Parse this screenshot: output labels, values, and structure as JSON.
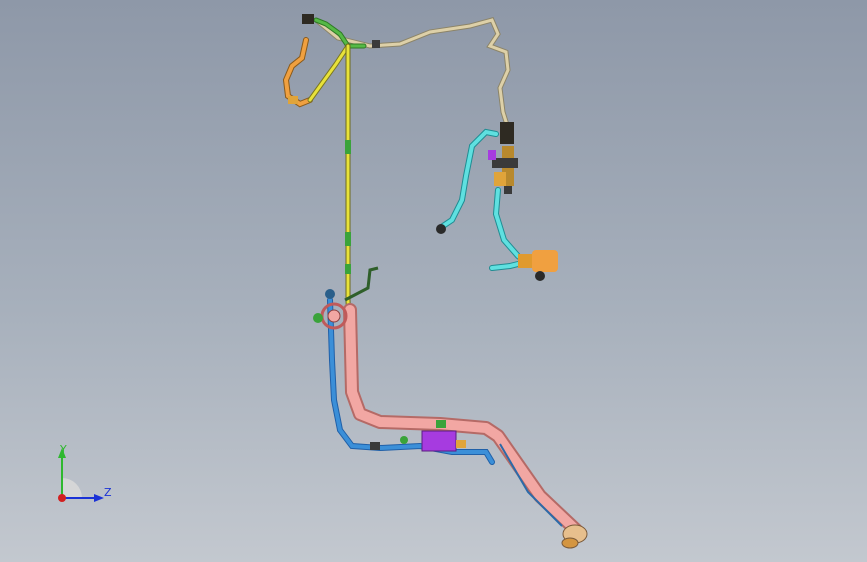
{
  "viewport": {
    "background_top": "#8e98a8",
    "background_bottom": "#c3c8cf"
  },
  "triad": {
    "y_label": "Y",
    "z_label": "Z",
    "y_color": "#2fb82f",
    "z_color": "#1a32d6",
    "x_color": "#d22020"
  },
  "model": {
    "part_colors": {
      "main_pipe": "#f2a7a3",
      "fuel_line": "#e8e23a",
      "harness_green": "#56b946",
      "hose_tan": "#ddd0a8",
      "hose_cyan": "#5fe0e0",
      "hose_orange": "#f0a040",
      "line_blue": "#3b8fd8",
      "filter_purple": "#a63be0",
      "fitting_dark": "#3a3a3a"
    }
  }
}
